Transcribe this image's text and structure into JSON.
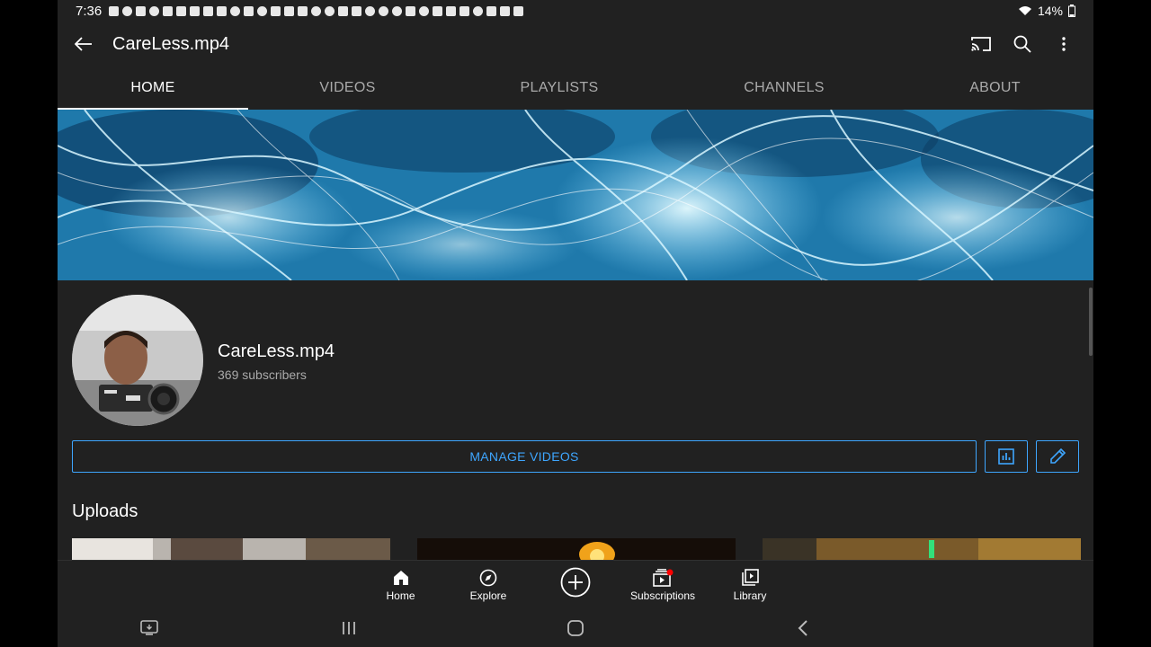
{
  "status_bar": {
    "time": "7:36",
    "battery": "14%"
  },
  "app_bar": {
    "title": "CareLess.mp4"
  },
  "tabs": [
    {
      "label": "HOME",
      "active": true
    },
    {
      "label": "VIDEOS",
      "active": false
    },
    {
      "label": "PLAYLISTS",
      "active": false
    },
    {
      "label": "CHANNELS",
      "active": false
    },
    {
      "label": "ABOUT",
      "active": false
    }
  ],
  "channel": {
    "name": "CareLess.mp4",
    "subscribers": "369 subscribers"
  },
  "actions": {
    "manage_videos": "MANAGE VIDEOS"
  },
  "uploads": {
    "title": "Uploads"
  },
  "bottom_nav": [
    {
      "label": "Home",
      "icon": "home-icon"
    },
    {
      "label": "Explore",
      "icon": "compass-icon"
    },
    {
      "label": "Subscriptions",
      "icon": "subscriptions-icon"
    },
    {
      "label": "Library",
      "icon": "library-icon"
    }
  ],
  "colors": {
    "accent": "#3ea6ff",
    "background": "#212121",
    "secondary_text": "#aaaaaa",
    "notification_dot": "#ff0000"
  }
}
